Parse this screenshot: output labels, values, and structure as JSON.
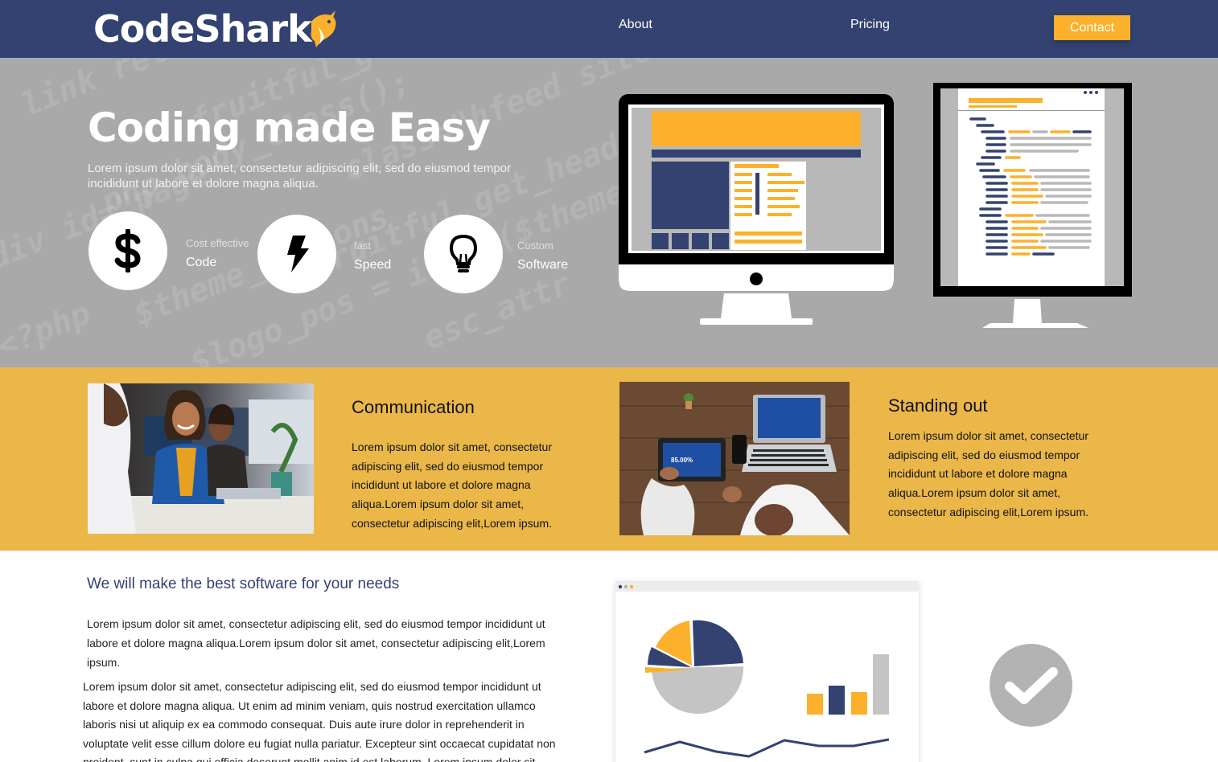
{
  "nav": {
    "logo": "CodeShark",
    "links": [
      "About",
      "Pricing"
    ],
    "contact_label": "Contact"
  },
  "hero": {
    "title": "Coding made Easy",
    "subtitle": "Lorem ipsum dolor sit amet, consectetur adipiscing elit, sed do eiusmod tempor incididunt ut labore et dolore magna aliqua.",
    "features": [
      {
        "icon": "dollar-icon",
        "small": "Cost effective",
        "big": "Code"
      },
      {
        "icon": "lightning-icon",
        "small": "fast",
        "big": "Speed"
      },
      {
        "icon": "lightbulb-icon",
        "small": "Custom",
        "big": "Software"
      }
    ]
  },
  "band": {
    "cards": [
      {
        "title": "Communication",
        "text": "Lorem ipsum dolor sit amet, consectetur adipiscing elit, sed do eiusmod tempor incididunt ut labore et dolore magna aliqua.Lorem ipsum dolor sit amet, consectetur adipiscing elit,Lorem ipsum."
      },
      {
        "title": "Standing out",
        "text": "Lorem ipsum dolor sit amet, consectetur adipiscing elit, sed do eiusmod tempor incididunt ut labore et dolore magna aliqua.Lorem ipsum dolor sit amet, consectetur adipiscing elit,Lorem ipsum."
      }
    ],
    "tablet_readout": "85.00%"
  },
  "lower": {
    "title": "We will make the best software for your needs",
    "p1": "Lorem ipsum dolor sit amet, consectetur adipiscing elit, sed do eiusmod tempor incididunt ut labore et dolore magna aliqua.Lorem ipsum dolor sit amet, consectetur adipiscing elit,Lorem ipsum.",
    "p2": "Lorem ipsum dolor sit amet, consectetur adipiscing elit, sed do eiusmod tempor incididunt ut labore et dolore magna aliqua. Ut enim ad minim veniam, quis nostrud exercitation ullamco laboris nisi ut aliquip ex ea commodo consequat. Duis aute irure dolor in reprehenderit in voluptate velit esse cillum dolore eu fugiat nulla pariatur. Excepteur sint occaecat cupidatat non proident, sunt in culpa qui officia deserunt mollit anim id est laborum. Lorem ipsum dolor sit amet."
  },
  "colors": {
    "navy": "#334270",
    "gold": "#fbb12c",
    "band": "#eab748",
    "hero_gray": "#a9a9a9"
  }
}
